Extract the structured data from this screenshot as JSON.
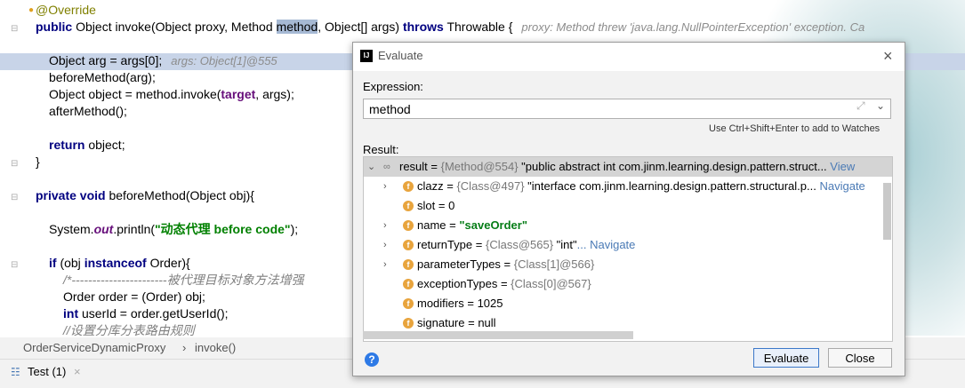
{
  "editor": {
    "annotation": "@Override",
    "sig_public": "public",
    "sig_part1": " Object invoke(Object proxy, Method ",
    "sig_method": "method",
    "sig_part2": ", Object[] args) ",
    "sig_throws": "throws",
    "sig_part3": " Throwable {",
    "sig_hint": "proxy: Method threw 'java.lang.NullPointerException' exception. Ca",
    "line_arg": "Object arg = args[0];",
    "line_arg_hint": "args: Object[1]@555",
    "line_before": "beforeMethod(arg);",
    "line_object_a": "Object object = ",
    "line_object_b": "method.invoke(",
    "line_object_target": "target",
    "line_object_c": ", args);",
    "line_after": "afterMethod();",
    "return_kw": "return",
    "return_rest": " object;",
    "close_brace": "}",
    "priv_kw": "private void",
    "priv_rest": " beforeMethod(Object obj){",
    "sys_a": "System.",
    "sys_out": "out",
    "sys_b": ".println(",
    "sys_str": "\"动态代理    before  code\"",
    "sys_c": ");",
    "if_kw": "if",
    "if_a": " (obj ",
    "if_instance": "instanceof",
    "if_b": " Order){",
    "comment1": "/*-----------------------被代理目标对象方法增强",
    "line_order": "Order order = (Order) obj;",
    "int_kw": "int",
    "line_userid": " userId = order.getUserId();",
    "comment2": "//设置分库分表路由规则"
  },
  "breadcrumb": {
    "class_name": "OrderServiceDynamicProxy",
    "separator": "›",
    "method_name": "invoke()"
  },
  "runbar": {
    "tab_label": "Test (1)",
    "close": "×"
  },
  "dialog": {
    "title": "Evaluate",
    "logo_text": "IJ",
    "close": "×",
    "expression_label": "Expression:",
    "expression_value": "method",
    "shortcut_hint": "Use Ctrl+Shift+Enter to add to Watches",
    "result_label": "Result:",
    "evaluate_button": "Evaluate",
    "close_button": "Close",
    "help": "?",
    "rows": [
      {
        "name": "result",
        "eq": " = ",
        "ref": "{Method@554}",
        "value": " \"public abstract int com.jinm.learning.design.pattern.struct...",
        "link": " View"
      },
      {
        "name": "clazz",
        "eq": " = ",
        "ref": "{Class@497}",
        "value": " \"interface com.jinm.learning.design.pattern.structural.p...",
        "link": " Navigate"
      },
      {
        "name": "slot",
        "eq": " = ",
        "ref": "",
        "value": "0",
        "link": ""
      },
      {
        "name": "name",
        "eq": " = ",
        "ref": "",
        "value": "\"saveOrder\"",
        "link": ""
      },
      {
        "name": "returnType",
        "eq": " = ",
        "ref": "{Class@565}",
        "value": " \"int\"",
        "link": "... Navigate"
      },
      {
        "name": "parameterTypes",
        "eq": " = ",
        "ref": "{Class[1]@566}",
        "value": "",
        "link": ""
      },
      {
        "name": "exceptionTypes",
        "eq": " = ",
        "ref": "{Class[0]@567}",
        "value": "",
        "link": ""
      },
      {
        "name": "modifiers",
        "eq": " = ",
        "ref": "",
        "value": "1025",
        "link": ""
      },
      {
        "name": "signature",
        "eq": " = ",
        "ref": "",
        "value": "null",
        "link": ""
      }
    ]
  }
}
